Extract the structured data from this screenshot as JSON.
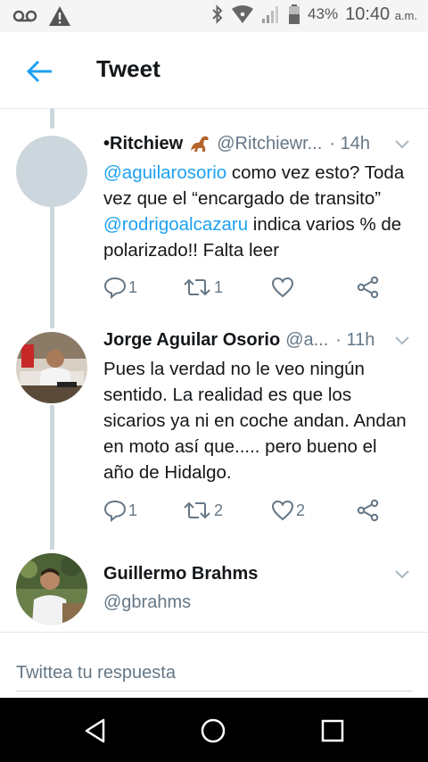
{
  "status_bar": {
    "battery_percent": "43%",
    "time": "10:40",
    "time_suffix": "a.m."
  },
  "header": {
    "title": "Tweet"
  },
  "tweets": [
    {
      "name": "•Ritchiew",
      "handle": "@Ritchiewr...",
      "time": "· 14h",
      "text_parts": [
        "@aguilarosorio",
        " como vez esto? Toda vez que el “encargado de transito” ",
        "@rodrigoalcazaru",
        "  indica varios %  de polarizado!! Falta leer"
      ],
      "reply_count": "1",
      "retweet_count": "1",
      "like_count": ""
    },
    {
      "name": "Jorge Aguilar Osorio",
      "handle": "@a...",
      "time": "· 11h",
      "text": "Pues la verdad no le veo ningún sentido. La realidad es que los sicarios ya ni en coche andan. Andan en moto así que..... pero bueno el año de Hidalgo.",
      "reply_count": "1",
      "retweet_count": "2",
      "like_count": "2"
    },
    {
      "name": "Guillermo Brahms",
      "handle": "@gbrahms"
    }
  ],
  "reply": {
    "placeholder": "Twittea tu respuesta"
  },
  "colors": {
    "accent": "#1da1f2",
    "secondary_text": "#657786",
    "thread_line": "#ccd6dd"
  },
  "icons": {
    "emoji_after_name": "dinosaur-emoji"
  }
}
